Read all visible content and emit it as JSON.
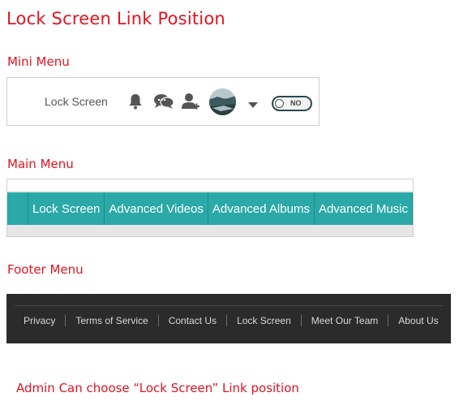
{
  "title": "Lock Screen Link Position",
  "sections": {
    "mini": "Mini Menu",
    "main": "Main Menu",
    "footer": "Footer Menu"
  },
  "mini_menu": {
    "link": "Lock Screen",
    "icons": [
      "bell-icon",
      "chat-icon",
      "add-friend-icon",
      "avatar",
      "caret-down-icon"
    ],
    "toggle_label": "NO"
  },
  "main_menu": {
    "items": [
      "Lock Screen",
      "Advanced Videos",
      "Advanced Albums",
      "Advanced Music"
    ],
    "bar_color": "#2aa9a8"
  },
  "footer_menu": {
    "items": [
      "Privacy",
      "Terms of Service",
      "Contact Us",
      "Lock Screen",
      "Meet Our Team",
      "About Us"
    ],
    "bg_color": "#2b2b2b"
  },
  "note": "Admin Can choose “Lock Screen” Link position",
  "colors": {
    "heading": "#e8121f"
  }
}
